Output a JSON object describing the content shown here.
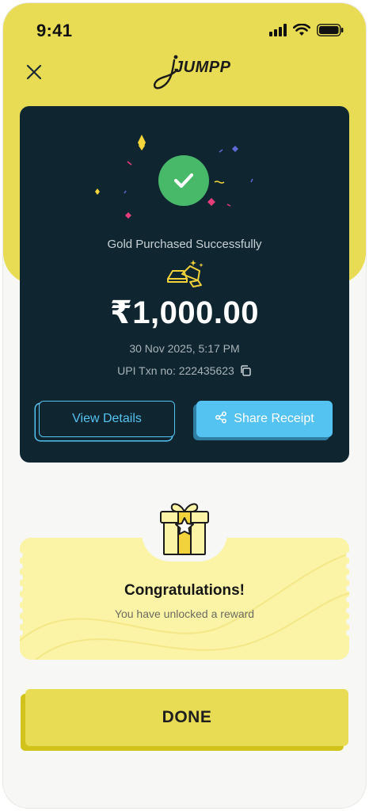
{
  "status_bar": {
    "time": "9:41",
    "icons": [
      "cellular-signal-icon",
      "wifi-icon",
      "battery-icon"
    ]
  },
  "header": {
    "close_icon": "close-icon",
    "logo_text": "JUMPP"
  },
  "transaction": {
    "status_text": "Gold Purchased Successfully",
    "amount": "₹1,000.00",
    "datetime": "30 Nov 2025, 5:17 PM",
    "txn_label": "UPI Txn no: 222435623",
    "view_details_label": "View Details",
    "share_receipt_label": "Share Receipt"
  },
  "reward": {
    "title": "Congratulations!",
    "subtitle": "You have unlocked a reward"
  },
  "footer": {
    "done_label": "DONE"
  },
  "colors": {
    "brand_yellow": "#e8dc55",
    "card_dark": "#0f2530",
    "success_green": "#48b869",
    "accent_blue": "#55c3f2",
    "ticket_yellow": "#fbf3a6"
  }
}
